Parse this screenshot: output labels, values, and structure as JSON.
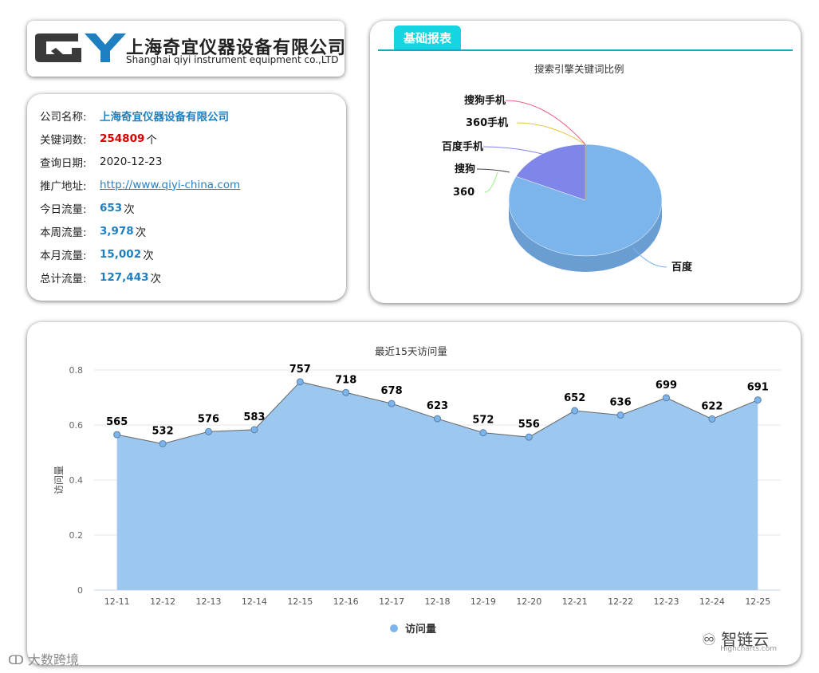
{
  "logo": {
    "mark": "QY",
    "company_cn": "上海奇宜仪器设备有限公司",
    "company_en": "Shanghai qiyi instrument equipment co.,LTD"
  },
  "info": {
    "rows": [
      {
        "label": "公司名称:",
        "value": "上海奇宜仪器设备有限公司",
        "unit": "",
        "style": "blue"
      },
      {
        "label": "关键词数:",
        "value": "254809",
        "unit": "个",
        "style": "red"
      },
      {
        "label": "查询日期:",
        "value": "2020-12-23",
        "unit": "",
        "style": "plain"
      },
      {
        "label": "推广地址:",
        "value": "http://www.qiyi-china.com",
        "unit": "",
        "style": "link"
      },
      {
        "label": "今日流量:",
        "value": "653",
        "unit": "次",
        "style": "blue"
      },
      {
        "label": "本周流量:",
        "value": "3,978",
        "unit": "次",
        "style": "blue"
      },
      {
        "label": "本月流量:",
        "value": "15,002",
        "unit": "次",
        "style": "blue"
      },
      {
        "label": "总计流量:",
        "value": "127,443",
        "unit": "次",
        "style": "blue"
      }
    ]
  },
  "report": {
    "tab_label": "基础报表"
  },
  "colors": {
    "accent": "#16d4e0",
    "area": "#9cc7ef",
    "pie_main": "#7cb5ec",
    "pie_second": "#8085e9"
  },
  "chart_data": [
    {
      "type": "pie",
      "title": "搜索引擎关键词比例",
      "slices": [
        {
          "name": "百度",
          "value": 82
        },
        {
          "name": "360",
          "value": 0
        },
        {
          "name": "搜狗",
          "value": 0
        },
        {
          "name": "百度手机",
          "value": 18
        },
        {
          "name": "360手机",
          "value": 0
        },
        {
          "name": "搜狗手机",
          "value": 0
        }
      ]
    },
    {
      "type": "area",
      "title": "最近15天访问量",
      "ylabel": "访问量",
      "xlabel": "",
      "categories": [
        "12-11",
        "12-12",
        "12-13",
        "12-14",
        "12-15",
        "12-16",
        "12-17",
        "12-18",
        "12-19",
        "12-20",
        "12-21",
        "12-22",
        "12-23",
        "12-24",
        "12-25"
      ],
      "series": [
        {
          "name": "访问量",
          "values": [
            565,
            532,
            576,
            583,
            757,
            718,
            678,
            623,
            572,
            556,
            652,
            636,
            699,
            622,
            691
          ]
        }
      ],
      "yticks": [
        "0",
        "0.2",
        "0.4",
        "0.6",
        "0.8"
      ],
      "legend": "bottom-center",
      "grid": true,
      "credit": "Highcharts.com"
    }
  ],
  "watermarks": {
    "bottom_left": "大数跨境",
    "bottom_right": "智链云"
  }
}
